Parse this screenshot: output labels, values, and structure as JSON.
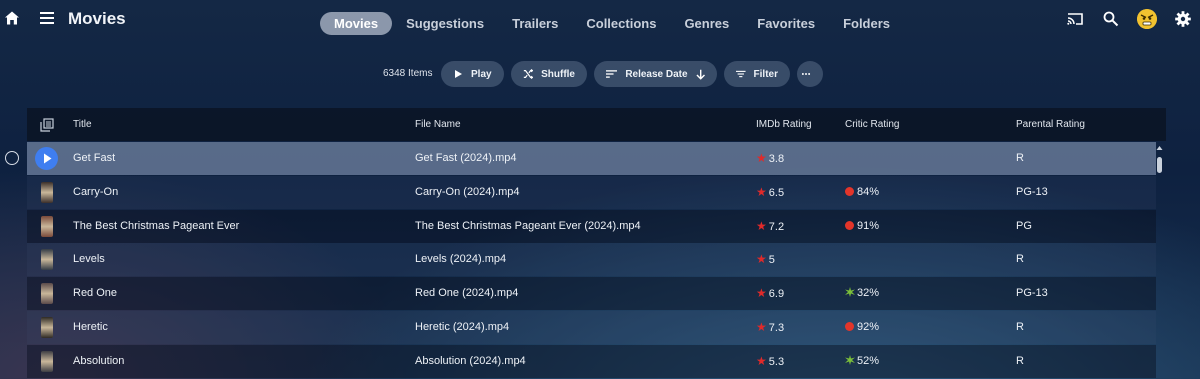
{
  "header": {
    "title": "Movies",
    "tabs": [
      "Movies",
      "Suggestions",
      "Trailers",
      "Collections",
      "Genres",
      "Favorites",
      "Folders"
    ],
    "active_tab": "Movies"
  },
  "toolbar": {
    "count": "6348 Items",
    "play": "Play",
    "shuffle": "Shuffle",
    "sort": "Release Date",
    "filter": "Filter"
  },
  "table": {
    "columns": {
      "title": "Title",
      "file": "File Name",
      "imdb": "IMDb Rating",
      "critic": "Critic Rating",
      "parental": "Parental Rating"
    },
    "rows": [
      {
        "title": "Get Fast",
        "file": "Get Fast (2024).mp4",
        "imdb": "3.8",
        "critic": "",
        "critic_type": "",
        "parental": "R"
      },
      {
        "title": "Carry-On",
        "file": "Carry-On (2024).mp4",
        "imdb": "6.5",
        "critic": "84%",
        "critic_type": "fresh",
        "parental": "PG-13"
      },
      {
        "title": "The Best Christmas Pageant Ever",
        "file": "The Best Christmas Pageant Ever (2024).mp4",
        "imdb": "7.2",
        "critic": "91%",
        "critic_type": "fresh",
        "parental": "PG"
      },
      {
        "title": "Levels",
        "file": "Levels (2024).mp4",
        "imdb": "5",
        "critic": "",
        "critic_type": "",
        "parental": "R"
      },
      {
        "title": "Red One",
        "file": "Red One (2024).mp4",
        "imdb": "6.9",
        "critic": "32%",
        "critic_type": "rotten",
        "parental": "PG-13"
      },
      {
        "title": "Heretic",
        "file": "Heretic (2024).mp4",
        "imdb": "7.3",
        "critic": "92%",
        "critic_type": "fresh",
        "parental": "R"
      },
      {
        "title": "Absolution",
        "file": "Absolution (2024).mp4",
        "imdb": "5.3",
        "critic": "52%",
        "critic_type": "rotten",
        "parental": "R"
      }
    ]
  },
  "icons": {
    "home": "home-icon",
    "menu": "menu-icon",
    "cast": "cast-icon",
    "search": "search-icon",
    "avatar": "avatar",
    "settings": "gear-icon",
    "play": "play-icon",
    "shuffle": "shuffle-icon",
    "sort": "sort-icon",
    "arrow": "arrow-down-icon",
    "filter": "filter-icon",
    "more": "more-icon",
    "select_all": "select-all-icon",
    "star": "star-icon",
    "fresh": "tomato-icon",
    "rotten": "splat-icon"
  },
  "colors": {
    "accent": "#3f7ef0",
    "star": "#e02a2a",
    "fresh": "#e3352a",
    "rotten": "#7bbf3a",
    "avatar": "#f2c230"
  }
}
